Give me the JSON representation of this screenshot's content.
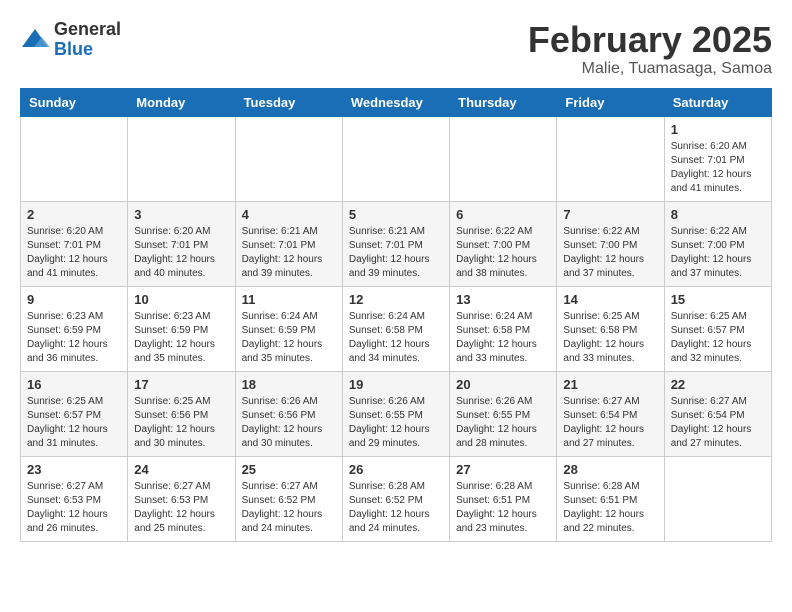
{
  "logo": {
    "general": "General",
    "blue": "Blue"
  },
  "title": "February 2025",
  "subtitle": "Malie, Tuamasaga, Samoa",
  "days_of_week": [
    "Sunday",
    "Monday",
    "Tuesday",
    "Wednesday",
    "Thursday",
    "Friday",
    "Saturday"
  ],
  "weeks": [
    [
      {
        "day": "",
        "info": ""
      },
      {
        "day": "",
        "info": ""
      },
      {
        "day": "",
        "info": ""
      },
      {
        "day": "",
        "info": ""
      },
      {
        "day": "",
        "info": ""
      },
      {
        "day": "",
        "info": ""
      },
      {
        "day": "1",
        "info": "Sunrise: 6:20 AM\nSunset: 7:01 PM\nDaylight: 12 hours and 41 minutes."
      }
    ],
    [
      {
        "day": "2",
        "info": "Sunrise: 6:20 AM\nSunset: 7:01 PM\nDaylight: 12 hours and 41 minutes."
      },
      {
        "day": "3",
        "info": "Sunrise: 6:20 AM\nSunset: 7:01 PM\nDaylight: 12 hours and 40 minutes."
      },
      {
        "day": "4",
        "info": "Sunrise: 6:21 AM\nSunset: 7:01 PM\nDaylight: 12 hours and 39 minutes."
      },
      {
        "day": "5",
        "info": "Sunrise: 6:21 AM\nSunset: 7:01 PM\nDaylight: 12 hours and 39 minutes."
      },
      {
        "day": "6",
        "info": "Sunrise: 6:22 AM\nSunset: 7:00 PM\nDaylight: 12 hours and 38 minutes."
      },
      {
        "day": "7",
        "info": "Sunrise: 6:22 AM\nSunset: 7:00 PM\nDaylight: 12 hours and 37 minutes."
      },
      {
        "day": "8",
        "info": "Sunrise: 6:22 AM\nSunset: 7:00 PM\nDaylight: 12 hours and 37 minutes."
      }
    ],
    [
      {
        "day": "9",
        "info": "Sunrise: 6:23 AM\nSunset: 6:59 PM\nDaylight: 12 hours and 36 minutes."
      },
      {
        "day": "10",
        "info": "Sunrise: 6:23 AM\nSunset: 6:59 PM\nDaylight: 12 hours and 35 minutes."
      },
      {
        "day": "11",
        "info": "Sunrise: 6:24 AM\nSunset: 6:59 PM\nDaylight: 12 hours and 35 minutes."
      },
      {
        "day": "12",
        "info": "Sunrise: 6:24 AM\nSunset: 6:58 PM\nDaylight: 12 hours and 34 minutes."
      },
      {
        "day": "13",
        "info": "Sunrise: 6:24 AM\nSunset: 6:58 PM\nDaylight: 12 hours and 33 minutes."
      },
      {
        "day": "14",
        "info": "Sunrise: 6:25 AM\nSunset: 6:58 PM\nDaylight: 12 hours and 33 minutes."
      },
      {
        "day": "15",
        "info": "Sunrise: 6:25 AM\nSunset: 6:57 PM\nDaylight: 12 hours and 32 minutes."
      }
    ],
    [
      {
        "day": "16",
        "info": "Sunrise: 6:25 AM\nSunset: 6:57 PM\nDaylight: 12 hours and 31 minutes."
      },
      {
        "day": "17",
        "info": "Sunrise: 6:25 AM\nSunset: 6:56 PM\nDaylight: 12 hours and 30 minutes."
      },
      {
        "day": "18",
        "info": "Sunrise: 6:26 AM\nSunset: 6:56 PM\nDaylight: 12 hours and 30 minutes."
      },
      {
        "day": "19",
        "info": "Sunrise: 6:26 AM\nSunset: 6:55 PM\nDaylight: 12 hours and 29 minutes."
      },
      {
        "day": "20",
        "info": "Sunrise: 6:26 AM\nSunset: 6:55 PM\nDaylight: 12 hours and 28 minutes."
      },
      {
        "day": "21",
        "info": "Sunrise: 6:27 AM\nSunset: 6:54 PM\nDaylight: 12 hours and 27 minutes."
      },
      {
        "day": "22",
        "info": "Sunrise: 6:27 AM\nSunset: 6:54 PM\nDaylight: 12 hours and 27 minutes."
      }
    ],
    [
      {
        "day": "23",
        "info": "Sunrise: 6:27 AM\nSunset: 6:53 PM\nDaylight: 12 hours and 26 minutes."
      },
      {
        "day": "24",
        "info": "Sunrise: 6:27 AM\nSunset: 6:53 PM\nDaylight: 12 hours and 25 minutes."
      },
      {
        "day": "25",
        "info": "Sunrise: 6:27 AM\nSunset: 6:52 PM\nDaylight: 12 hours and 24 minutes."
      },
      {
        "day": "26",
        "info": "Sunrise: 6:28 AM\nSunset: 6:52 PM\nDaylight: 12 hours and 24 minutes."
      },
      {
        "day": "27",
        "info": "Sunrise: 6:28 AM\nSunset: 6:51 PM\nDaylight: 12 hours and 23 minutes."
      },
      {
        "day": "28",
        "info": "Sunrise: 6:28 AM\nSunset: 6:51 PM\nDaylight: 12 hours and 22 minutes."
      },
      {
        "day": "",
        "info": ""
      }
    ]
  ]
}
